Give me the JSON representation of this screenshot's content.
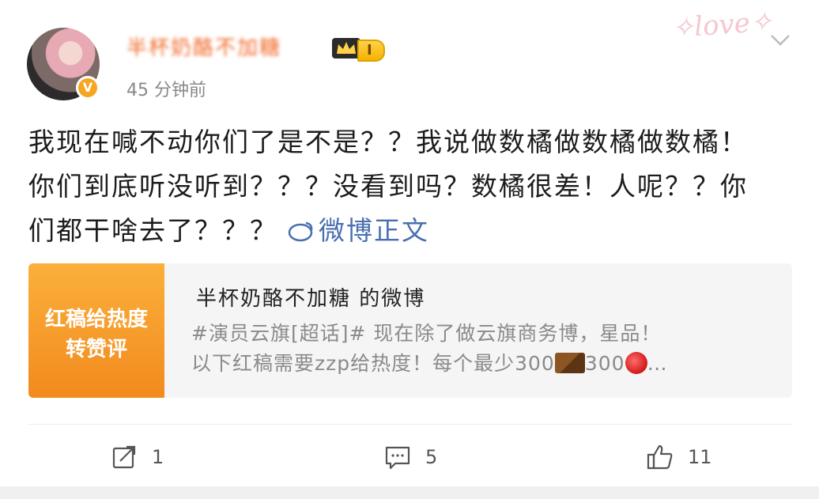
{
  "author": {
    "name": "半杯奶酪不加糖",
    "level": "I",
    "verified_mark": "V",
    "time": "45 分钟前"
  },
  "decoration": {
    "logo_text": "love"
  },
  "post": {
    "text": "我现在喊不动你们了是不是？？我说做数橘做数橘做数橘！你们到底听没听到？？？没看到吗？数橘很差！人呢？？你们都干啥去了？？？",
    "fulltext_link": "微博正文"
  },
  "repost_card": {
    "thumb_line1": "红稿给热度",
    "thumb_line2": "转赞评",
    "title": "半杯奶酪不加糖 的微博",
    "desc_line1": "#演员云旗[超话]# 现在除了做云旗商务博，星品！",
    "desc_line2_a": "以下红稿需要zzp给热度！每个最少300",
    "desc_line2_b": "300",
    "desc_line2_c": "…"
  },
  "actions": {
    "repost_count": "1",
    "comment_count": "5",
    "like_count": "11"
  },
  "colors": {
    "accent_orange": "#f26a2a",
    "link_blue": "#4a6fb0",
    "card_bg": "#f5f5f5"
  }
}
